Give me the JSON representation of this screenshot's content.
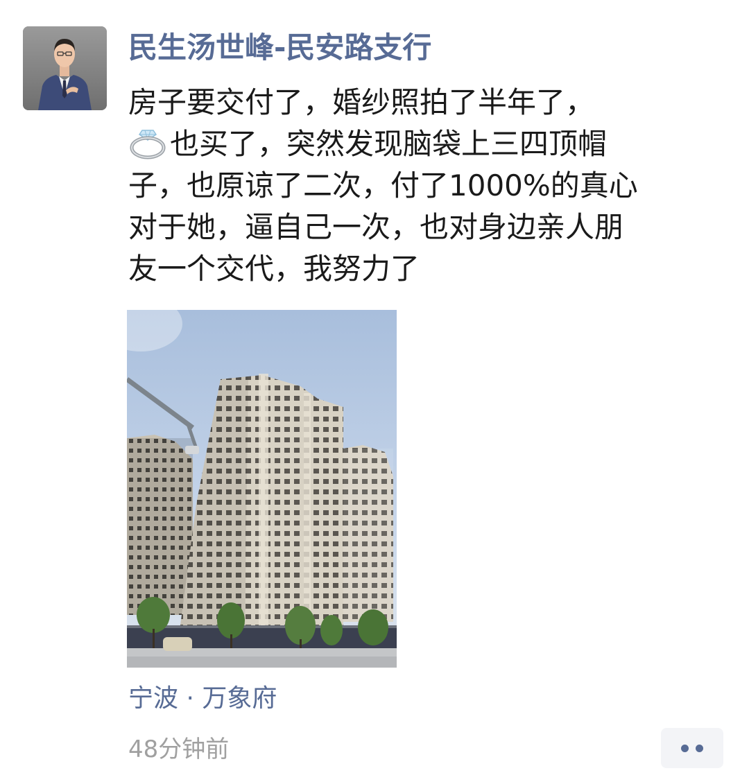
{
  "post": {
    "author": "民生汤世峰-民安路支行",
    "text_line1": "房子要交付了，婚纱照拍了半年了，",
    "ring_icon": "ring-emoji",
    "text_rest": "也买了，突然发现脑袋上三四顶帽\n子，也原谅了二次，付了1000%的真心\n对于她，逼自己一次，也对身边亲人朋\n友一个交代，我努力了",
    "location": "宁波 · 万象府",
    "time": "48分钟前",
    "more_icon": "more-dots-icon"
  },
  "colors": {
    "link": "#576b95",
    "text": "#1a1a1a",
    "muted": "#a0a0a0",
    "button_bg": "#f3f4f7"
  }
}
